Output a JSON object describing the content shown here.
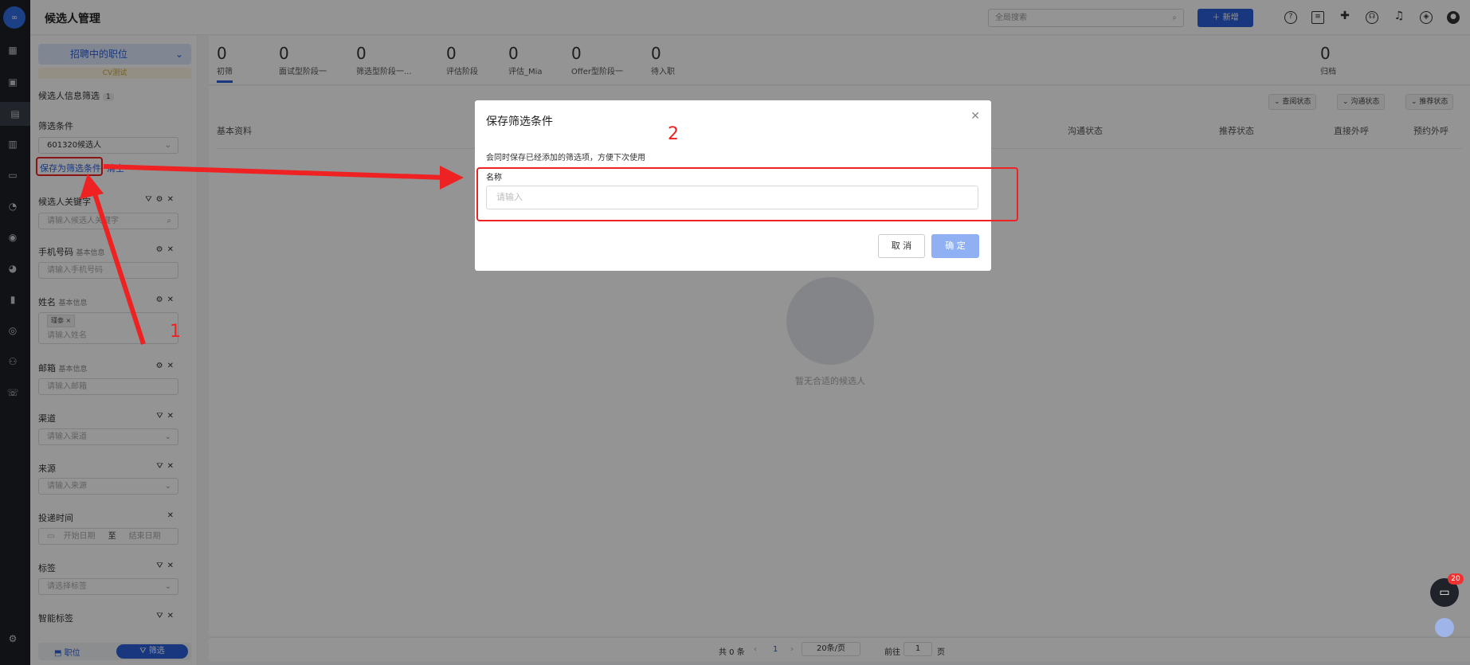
{
  "header": {
    "title": "候选人管理",
    "search_placeholder": "全局搜索",
    "new_label": "新增"
  },
  "sidebar": {
    "job_selector": "招聘中的职位",
    "cv_tag": "CV测试",
    "filter_title": "候选人信息筛选",
    "filter_count": "1",
    "filter_cond_label": "筛选条件",
    "filter_cond_value": "601320候选人",
    "save_as_label": "保存为筛选条件",
    "clear_label": "清空",
    "fields": [
      {
        "label": "候选人关键字",
        "sub": "",
        "placeholder": "请输入候选人关键字"
      },
      {
        "label": "手机号码",
        "sub": "基本信息",
        "placeholder": "请输入手机号码"
      },
      {
        "label": "姓名",
        "sub": "基本信息",
        "placeholder": "请输入姓名",
        "tag": "瑾泰"
      },
      {
        "label": "邮箱",
        "sub": "基本信息",
        "placeholder": "请输入邮箱"
      },
      {
        "label": "渠道",
        "sub": "",
        "placeholder": "请输入渠道"
      },
      {
        "label": "来源",
        "sub": "",
        "placeholder": "请输入来源"
      },
      {
        "label": "投递时间",
        "sub": "",
        "start": "开始日期",
        "to": "至",
        "end": "结束日期"
      },
      {
        "label": "标签",
        "sub": "",
        "placeholder": "请选择标签"
      },
      {
        "label": "智能标签",
        "sub": ""
      }
    ],
    "bottom_job": "职位",
    "bottom_filter": "筛选"
  },
  "stages": [
    {
      "count": "0",
      "label": "初筛"
    },
    {
      "count": "0",
      "label": "面试型阶段一"
    },
    {
      "count": "0",
      "label": "筛选型阶段一..."
    },
    {
      "count": "0",
      "label": "评估阶段"
    },
    {
      "count": "0",
      "label": "评估_Mia"
    },
    {
      "count": "0",
      "label": "Offer型阶段一"
    },
    {
      "count": "0",
      "label": "待入职"
    },
    {
      "count": "0",
      "label": "归档"
    }
  ],
  "main": {
    "filters": [
      "查阅状态",
      "沟通状态",
      "推荐状态"
    ],
    "columns": [
      "基本资料",
      "沟通状态",
      "推荐状态",
      "直接外呼",
      "预约外呼"
    ],
    "empty_text": "暂无合适的候选人"
  },
  "pager": {
    "total": "共 0 条",
    "page": "1",
    "size": "20条/页",
    "goto": "前往",
    "goto_val": "1",
    "page_unit": "页"
  },
  "modal": {
    "title": "保存筛选条件",
    "desc": "会同时保存已经添加的筛选项，方便下次使用",
    "name_label": "名称",
    "name_placeholder": "请输入",
    "cancel": "取 消",
    "ok": "确 定"
  },
  "annotations": {
    "one": "1",
    "two": "2"
  },
  "chat_badge": "20",
  "colors": {
    "accent": "#2b5fd9",
    "annotation": "#e22222"
  }
}
